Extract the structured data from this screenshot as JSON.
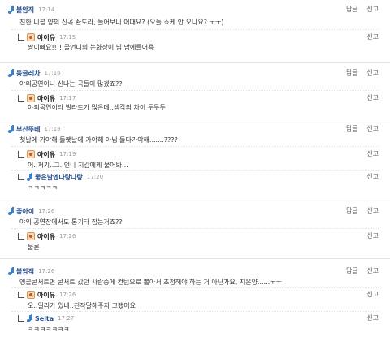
{
  "actions": {
    "reply": "답글",
    "report": "신고"
  },
  "threads": [
    {
      "author": "불암적",
      "time": "17:14",
      "text": "친한 니콜 양의 신곡 좐도라, 들어보니 어때요? (오늘 쇼케 안 오나요? ㅜㅜ)",
      "replies": [
        {
          "author": "아이유",
          "time": "17:15",
          "text": "짱이빠요!!!! 콜언니의 눈화장이 넘 맘에들어용",
          "icon": "avatar"
        }
      ]
    },
    {
      "author": "동글레차",
      "time": "17:16",
      "text": "야외공연이니 신나는 곡들이 많겠죠??",
      "replies": [
        {
          "author": "아이유",
          "time": "17:17",
          "text": "야외공연이라 발라드가 많은데..생각의 차이 두두두",
          "icon": "avatar"
        }
      ]
    },
    {
      "author": "부산뚜베",
      "time": "17:18",
      "text": "첫날에 가야해 둘쨋날에 가야해 아님 둘다가야해.......????",
      "replies": [
        {
          "author": "아이유",
          "time": "17:19",
          "text": "어..저기..그..언니 지갑에게 물어봐...",
          "icon": "avatar"
        },
        {
          "author": "좋은날엔나랑나랑",
          "time": "17:20",
          "text": "ㅋㅋㅋㅋㅋ",
          "icon": "note"
        }
      ]
    },
    {
      "author": "좋아이",
      "time": "17:26",
      "text": "야외 공연장에서도 통기타 잡는거죠??",
      "replies": [
        {
          "author": "아이유",
          "time": "17:26",
          "text": "물론",
          "icon": "avatar"
        }
      ]
    },
    {
      "author": "불암적",
      "time": "17:26",
      "text": "앵콜콘서트면 콘서트 갔던 사람중에 컨텀으로 뽑아서 초청해야 하는 거 아닌가요, 지은양......ㅜㅜ",
      "replies": [
        {
          "author": "아이유",
          "time": "17:26",
          "text": "오..일리가 있네..진작말해주지 그랬어요",
          "icon": "avatar"
        },
        {
          "author": "Seita",
          "time": "17:27",
          "text": "ㅋㅋㅋㅋㅋㅋㅋ",
          "icon": "note"
        }
      ]
    }
  ]
}
